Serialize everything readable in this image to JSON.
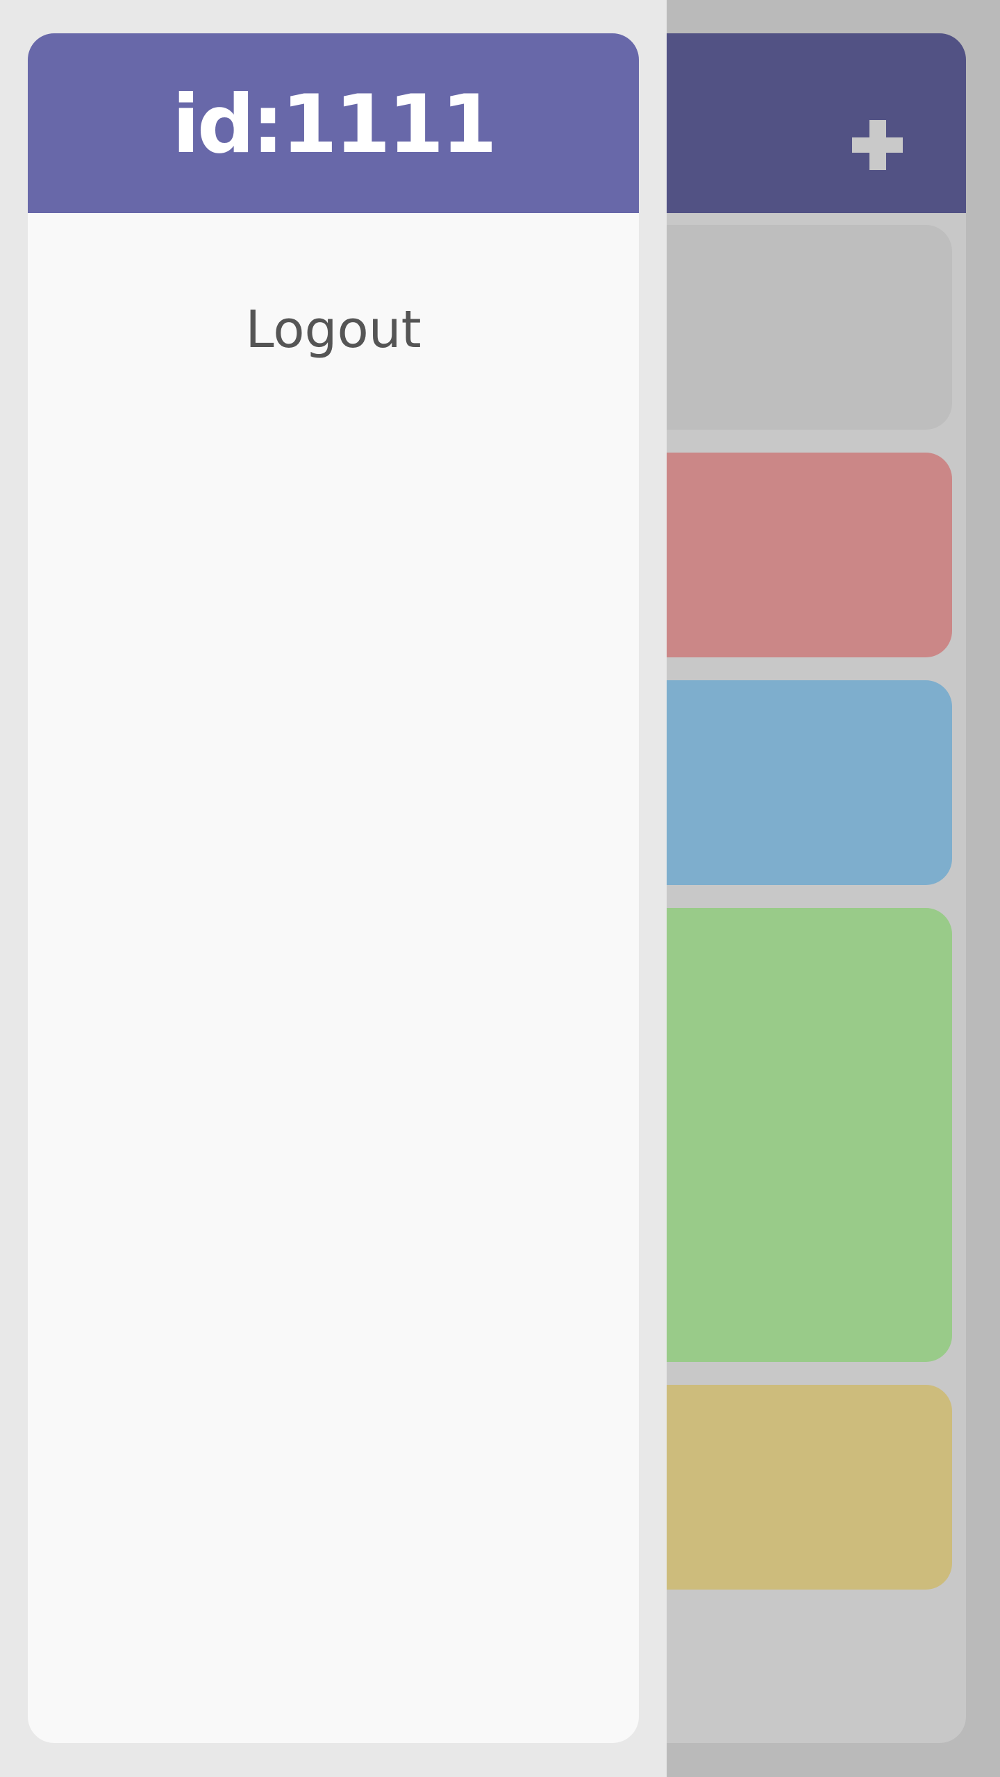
{
  "drawer": {
    "user_id": "id:1111",
    "logout_label": "Logout"
  },
  "app": {
    "add_icon": "plus-icon"
  },
  "notes": [
    {
      "color": "#bebebe"
    },
    {
      "color": "#cb8787"
    },
    {
      "color": "#7eaecd"
    },
    {
      "color": "#99cb89"
    },
    {
      "color": "#cdbc7c"
    }
  ],
  "colors": {
    "drawer_header": "#6868a9",
    "app_header": "#525284",
    "drawer_background": "#f9f9f9",
    "overlay_background": "#c8c8c8"
  }
}
